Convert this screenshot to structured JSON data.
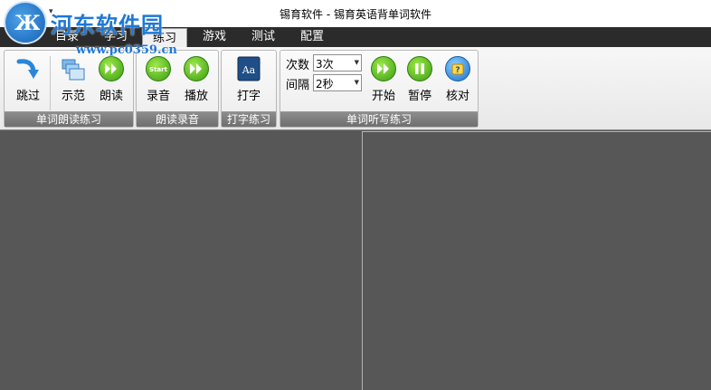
{
  "window": {
    "title": "锡育软件 - 锡育英语背单词软件"
  },
  "watermark": {
    "text": "河东软件园",
    "url": "www.pc0359.cn"
  },
  "tabs": [
    {
      "label": "目录"
    },
    {
      "label": "学习"
    },
    {
      "label": "练习",
      "active": true
    },
    {
      "label": "游戏"
    },
    {
      "label": "测试"
    },
    {
      "label": "配置"
    }
  ],
  "ribbon": {
    "groups": [
      {
        "label": "单词朗读练习",
        "buttons": [
          {
            "label": "跳过",
            "icon": "skip-arrow-icon"
          },
          {
            "label": "示范",
            "icon": "folders-icon"
          },
          {
            "label": "朗读",
            "icon": "play-forward-icon"
          }
        ]
      },
      {
        "label": "朗读录音",
        "buttons": [
          {
            "label": "录音",
            "icon": "start-record-icon",
            "icon_text": "Start"
          },
          {
            "label": "播放",
            "icon": "play-forward-icon"
          }
        ]
      },
      {
        "label": "打字练习",
        "buttons": [
          {
            "label": "打字",
            "icon": "font-book-icon",
            "icon_text": "Aa"
          }
        ]
      },
      {
        "label": "单词听写练习",
        "fields": [
          {
            "label": "次数",
            "value": "3次"
          },
          {
            "label": "间隔",
            "value": "2秒"
          }
        ],
        "buttons": [
          {
            "label": "开始",
            "icon": "play-forward-icon"
          },
          {
            "label": "暂停",
            "icon": "pause-icon"
          },
          {
            "label": "核对",
            "icon": "check-help-icon"
          }
        ]
      }
    ]
  },
  "colors": {
    "workspace": "#575757",
    "tabstrip": "#2b2b2b",
    "accent_green": "#3a9d12",
    "accent_blue": "#1c6fc8"
  }
}
